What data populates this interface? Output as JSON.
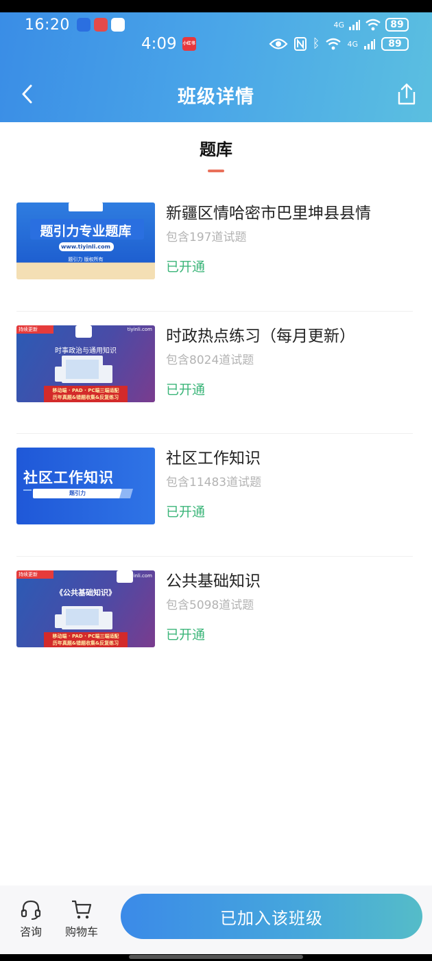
{
  "status_outer": {
    "time": "16:20",
    "network": "4G",
    "battery": "89"
  },
  "status_inner": {
    "time": "4:09",
    "xhs_label": "小红书",
    "network": "4G",
    "battery": "89"
  },
  "nav": {
    "title": "班级详情",
    "back_icon": "back-chevron-icon",
    "share_icon": "share-icon"
  },
  "tab": {
    "label": "题库"
  },
  "items": [
    {
      "title": "新疆区情哈密市巴里坤县县情",
      "count": "包含197道试题",
      "status": "已开通",
      "thumb": {
        "headline": "题引力专业题库",
        "url": "www.tiyinli.com",
        "footer": "题引力 版权所有"
      }
    },
    {
      "title": "时政热点练习（每月更新）",
      "count": "包含8024道试题",
      "status": "已开通",
      "thumb": {
        "badge": "持续更新",
        "site": "tiyinli.com",
        "headline": "时事政治与通用知识",
        "band1": "移动端 · PAD · PC端三端适配",
        "band2": "历年真题&错题收集&反复练习"
      }
    },
    {
      "title": "社区工作知识",
      "count": "包含11483道试题",
      "status": "已开通",
      "thumb": {
        "headline": "社区工作知识",
        "sub": "题引力"
      }
    },
    {
      "title": "公共基础知识",
      "count": "包含5098道试题",
      "status": "已开通",
      "thumb": {
        "badge": "持续更新",
        "site": "tiyinli.com",
        "headline": "《公共基础知识》",
        "band1": "移动端 · PAD · PC端三端适配",
        "band2": "历年真题&错题收集&反复练习"
      }
    }
  ],
  "bottom": {
    "consult_label": "咨询",
    "cart_label": "购物车",
    "joined_label": "已加入该班级"
  },
  "colors": {
    "header_start": "#3a8de6",
    "header_end": "#5bbfe0",
    "status_green": "#3bb579",
    "tab_accent": "#e9705a"
  }
}
